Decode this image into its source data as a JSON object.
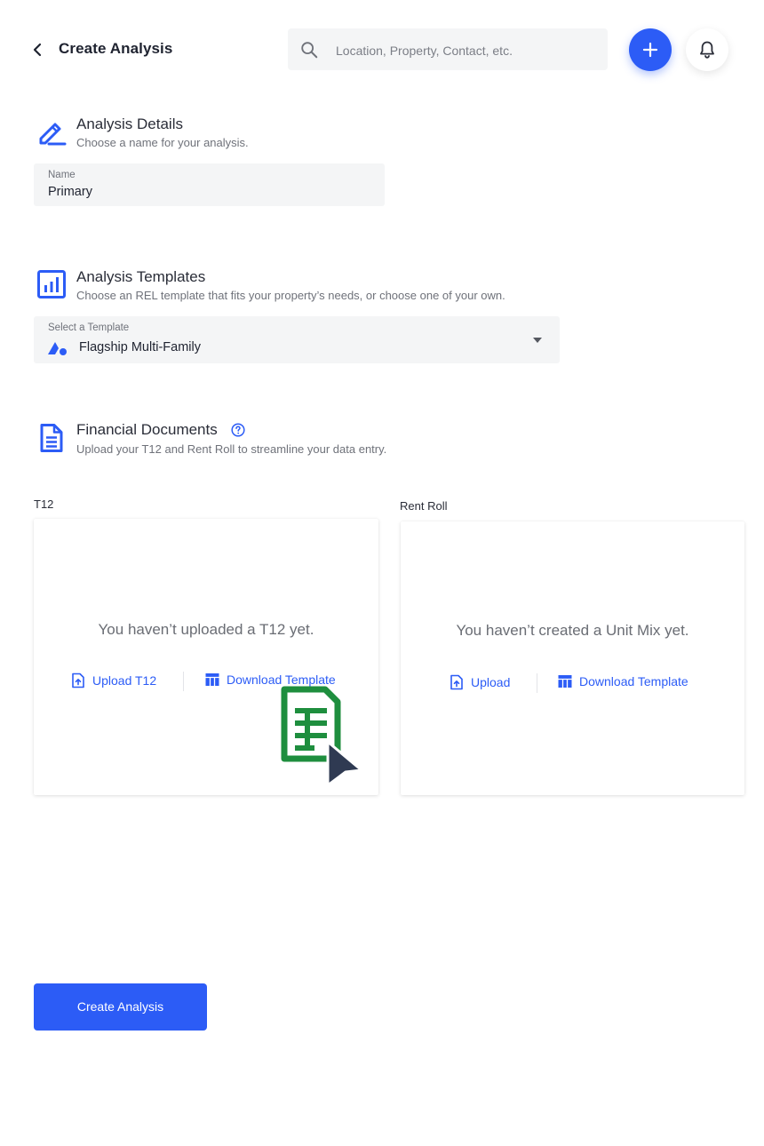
{
  "header": {
    "title": "Create Analysis",
    "search_placeholder": "Location, Property, Contact, etc."
  },
  "analysis_details": {
    "title": "Analysis Details",
    "subtitle": "Choose a name for your analysis.",
    "name_label": "Name",
    "name_value": "Primary"
  },
  "analysis_templates": {
    "title": "Analysis Templates",
    "subtitle": "Choose an REL template that fits your property’s needs, or choose one of your own.",
    "select_label": "Select a Template",
    "selected_value": "Flagship Multi-Family"
  },
  "financial_documents": {
    "title": "Financial Documents",
    "subtitle": "Upload your T12 and Rent Roll to streamline your data entry.",
    "t12": {
      "label": "T12",
      "empty_message": "You haven’t uploaded a T12 yet.",
      "upload_label": "Upload T12",
      "download_label": "Download Template"
    },
    "rent_roll": {
      "label": "Rent Roll",
      "empty_message": "You haven’t created a Unit Mix yet.",
      "upload_label": "Upload",
      "download_label": "Download Template"
    }
  },
  "footer": {
    "create_label": "Create Analysis"
  },
  "colors": {
    "accent": "#2c5cf6",
    "excel_green": "#1e8e3e",
    "cursor": "#2f3a52"
  },
  "icons": [
    "back-arrow-icon",
    "search-icon",
    "plus-icon",
    "bell-icon",
    "pencil-icon",
    "chart-icon",
    "document-icon",
    "help-icon",
    "brand-logo-icon",
    "dropdown-arrow-icon",
    "upload-icon",
    "table-icon",
    "spreadsheet-icon",
    "cursor-icon"
  ]
}
